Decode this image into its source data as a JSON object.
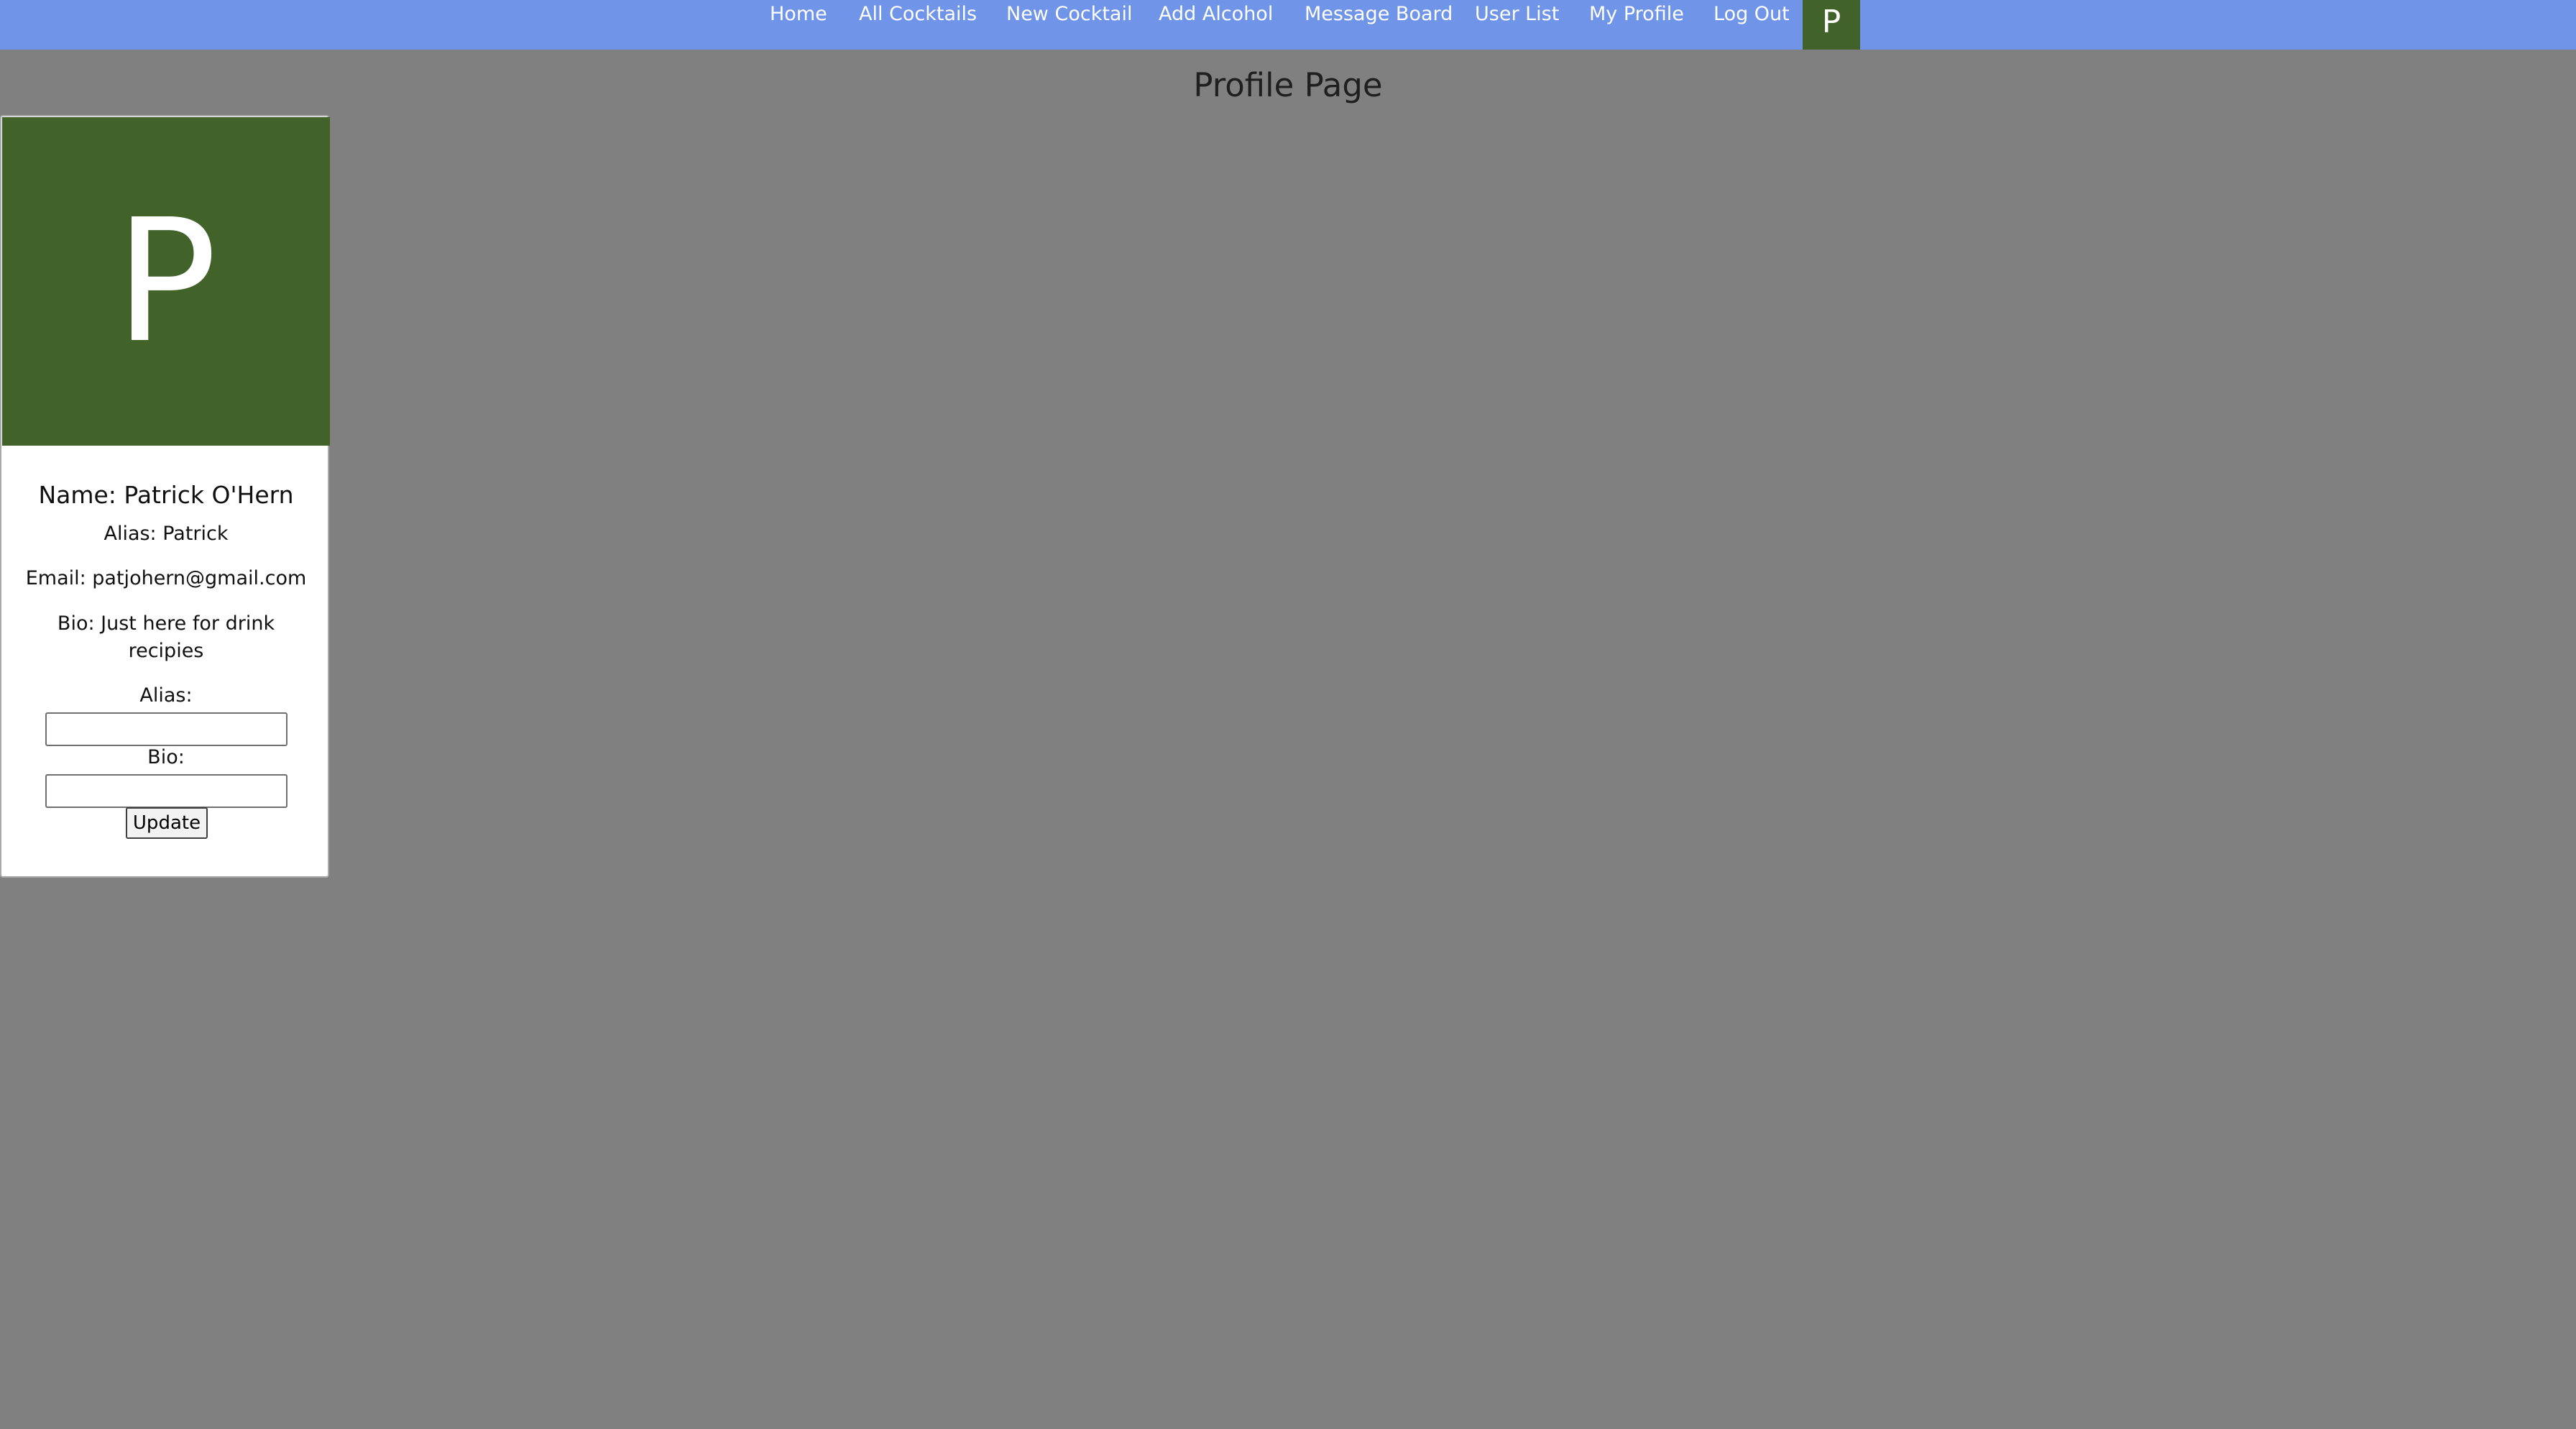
{
  "nav": {
    "items": [
      {
        "label": "Home"
      },
      {
        "label": "All Cocktails"
      },
      {
        "label": "New Cocktail"
      },
      {
        "label": "Add Alcohol"
      },
      {
        "label": "Message Board"
      },
      {
        "label": "User List"
      },
      {
        "label": "My Profile"
      },
      {
        "label": "Log Out"
      }
    ],
    "avatar_letter": "P",
    "background_color": "#6f94e8",
    "avatar_color": "#41632a"
  },
  "page": {
    "title": "Profile Page",
    "background_color": "#808080"
  },
  "profile": {
    "avatar_letter": "P",
    "avatar_color": "#41632a",
    "name": "Name: Patrick O'Hern",
    "alias": "Alias: Patrick",
    "email": "Email: patjohern@gmail.com",
    "bio": "Bio: Just here for drink recipies"
  },
  "form": {
    "alias_label": "Alias:",
    "alias_value": "",
    "bio_label": "Bio:",
    "bio_value": "",
    "update_label": "Update"
  }
}
